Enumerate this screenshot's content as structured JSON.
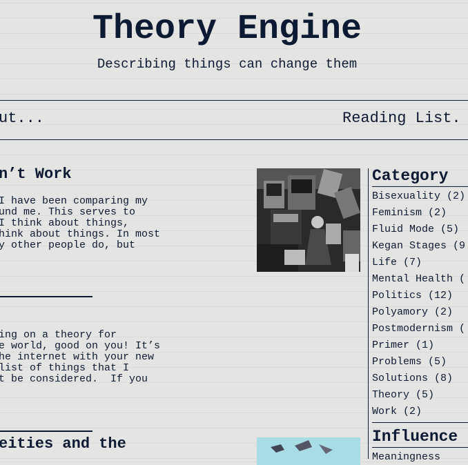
{
  "header": {
    "title": "Theory Engine",
    "tagline": "Describing things can change them"
  },
  "nav": {
    "left_item": "ut...",
    "right_item": "Reading List."
  },
  "posts": [
    {
      "title": "n’t Work",
      "excerpt": "I have been comparing my\nund me. This serves to\nI think about things,\nhink about things. In most\ny other people do, but"
    },
    {
      "title": "",
      "excerpt": "ing on a theory for\ne world, good on you! It’s\nhe internet with your new\nlist of things that I\nt be considered.  If you"
    },
    {
      "title": "eities and the",
      "excerpt": ""
    }
  ],
  "sidebar": {
    "categories_title": "Category",
    "categories": [
      "Bisexuality (2)",
      "Feminism (2)",
      "Fluid Mode (5)",
      "Kegan Stages (9",
      "Life (7)",
      "Mental Health (",
      "Politics (12)",
      "Polyamory (2)",
      "Postmodernism (",
      "Primer (1)",
      "Problems (5)",
      "Solutions (8)",
      "Theory (5)",
      "Work (2)"
    ],
    "influences_title": "Influence",
    "influences_first": "Meaningness"
  },
  "colors": {
    "text": "#0d1a33",
    "background": "#e4e4e2"
  }
}
